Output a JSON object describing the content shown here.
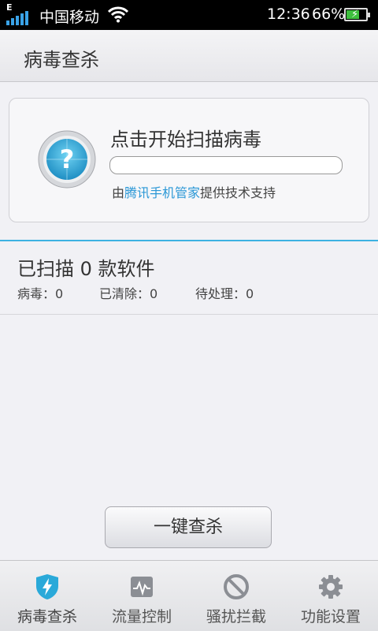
{
  "status_bar": {
    "network_type": "E",
    "carrier": "中国移动",
    "time": "12:36",
    "battery_percent": "66%",
    "battery_level": 0.66,
    "icons": [
      "signal-icon",
      "wifi-icon",
      "battery-charging-icon"
    ]
  },
  "header": {
    "title": "病毒查杀"
  },
  "scan_card": {
    "title": "点击开始扫描病毒",
    "progress": 0,
    "support_prefix": "由",
    "support_brand": "腾讯手机管家",
    "support_suffix": "提供技术支持",
    "icon": "question-shield-icon"
  },
  "summary": {
    "scanned_text": "已扫描 0 款软件",
    "virus": "病毒：0",
    "cleaned": "已清除：0",
    "pending": "待处理：0"
  },
  "action_button": {
    "label": "一键查杀"
  },
  "tabs": [
    {
      "label": "病毒查杀",
      "icon": "shield-bolt-icon",
      "active": true
    },
    {
      "label": "流量控制",
      "icon": "traffic-monitor-icon",
      "active": false
    },
    {
      "label": "骚扰拦截",
      "icon": "block-icon",
      "active": false
    },
    {
      "label": "功能设置",
      "icon": "gear-icon",
      "active": false
    }
  ],
  "colors": {
    "accent": "#3db2e2",
    "brand_link": "#2a97d6"
  }
}
